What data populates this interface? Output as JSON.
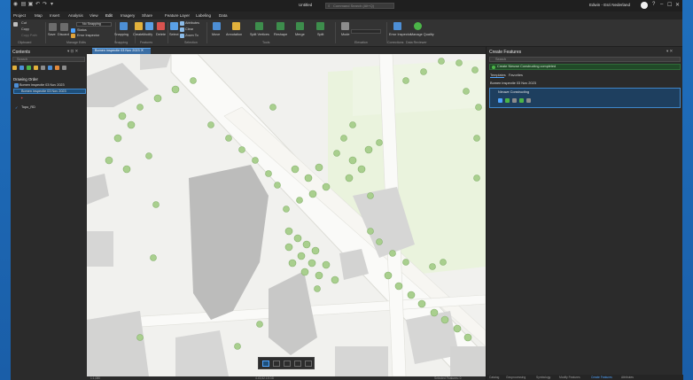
{
  "window": {
    "project_name": "Untitled",
    "command_search_placeholder": "Command Search (Alt+Q)",
    "user": "Edwin - Esri Nederland",
    "minimize": "–",
    "maximize": "☐",
    "close": "✕"
  },
  "tabs": [
    "Project",
    "Map",
    "Insert",
    "Analysis",
    "View",
    "Edit",
    "Imagery",
    "Share",
    "Feature Layer",
    "Labeling",
    "Data"
  ],
  "active_tab": "Edit",
  "ribbon": {
    "clipboard": {
      "cut": "Cut",
      "copy": "Copy",
      "copy_path": "Copy Path",
      "label": "Clipboard"
    },
    "manage_edits": {
      "save": "Save",
      "discard": "Discard",
      "snapping": "No Snapping",
      "status": "Status",
      "error_inspector": "Error Inspector",
      "label": "Manage Edits"
    },
    "snapping": {
      "snapping": "Snapping",
      "label": "Snapping"
    },
    "features": {
      "create": "Create",
      "modify": "Modify",
      "delete": "Delete",
      "label": "Features"
    },
    "selection": {
      "select": "Select",
      "attributes": "Attributes",
      "clear": "Clear",
      "zoom_to": "Zoom To",
      "label": "Selection"
    },
    "tools": {
      "move": "Move",
      "annotation": "Annotation",
      "split_vertices": "Split Vertices",
      "reshape": "Reshape",
      "merge": "Merge",
      "split": "Split",
      "label": "Tools"
    },
    "elevation": {
      "mode": "Mode",
      "label": "Elevation"
    },
    "corrections": {
      "label": "Corrections"
    },
    "data_reviewer": {
      "error_inspector": "Error Inspector",
      "manage_quality": "Manage Quality",
      "label": "Data Reviewer"
    }
  },
  "contents": {
    "title": "Contents",
    "search_placeholder": "Search",
    "drawing_order": "Drawing Order",
    "layers": [
      {
        "name": "Bomen inspectie 03 Nov 2023"
      },
      {
        "name": "Bomen inspectie 03 Nov 2023"
      },
      {
        "name": "Topo_RD"
      }
    ]
  },
  "map": {
    "tab_label": "Bomen inspectie 03 Nov 2023",
    "scale": "1:1,080",
    "coordinates": "4.43,52.15 DD",
    "selected_features": "Selected Features: 0"
  },
  "create_features": {
    "title": "Create Features",
    "search_placeholder": "Search",
    "message": "Create Nieuwe Constructing completed",
    "tabs": [
      "Templates",
      "Favorites"
    ],
    "layer": "Bomen inspectie 03 Nov 2023",
    "template": "Nieuwe Constructing",
    "bottom_tabs": [
      "Catalog",
      "Geoprocessing",
      "Symbology",
      "Modify Features",
      "Create Features",
      "Attributes"
    ]
  },
  "colors": {
    "accent": "#4ea3ff",
    "desktop": "#1e72c0",
    "panel": "#2b2b2b",
    "ribbon": "#333333",
    "map_bg": "#f1f1ee",
    "tree": "#a9cf8e",
    "building": "#cfcfcf"
  }
}
